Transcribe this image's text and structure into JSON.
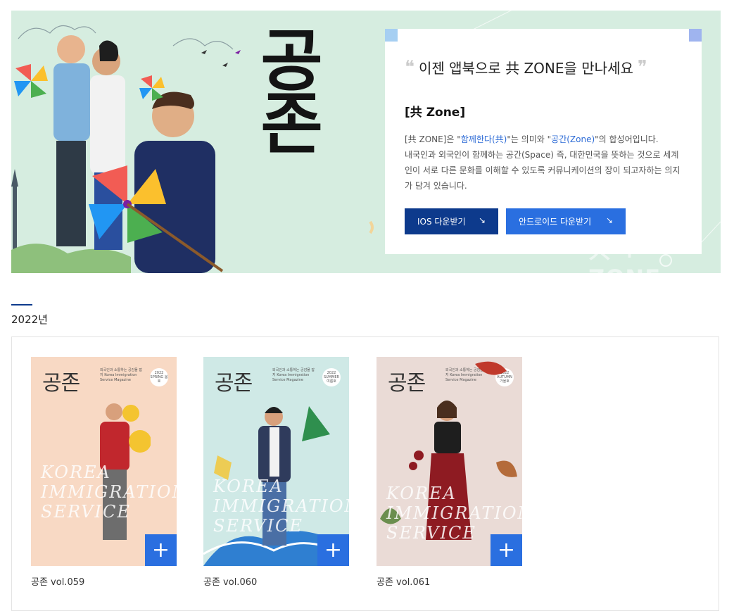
{
  "banner": {
    "logo": "공존",
    "headline": "이젠 앱북으로 共 ZONE을 만나세요",
    "zone_title": "[共 Zone]",
    "desc_prefix": "[共 ZONE]은 \"",
    "desc_hl1": "함께한다(共)",
    "desc_mid": "\"는 의미와 \"",
    "desc_hl2": "공간(Zone)",
    "desc_rest": "\"의 합성어입니다.",
    "desc_line2": "내국인과 외국인이 함께하는 공간(Space) 즉, 대한민국을 뜻하는 것으로 세계인이 서로 다른 문화를 이해할 수 있도록 커뮤니케이션의 장이 되고자하는 의지가 담겨 있습니다.",
    "ios_button": "IOS 다운받기",
    "android_button": "안드로이드 다운받기",
    "watermark": "共 + ZONE"
  },
  "section": {
    "year": "2022년"
  },
  "magazines": [
    {
      "label": "공존 vol.059",
      "cover_title": "공존",
      "cover_sub": "외국인과 소통하는 공감물 잡지 Korea Immigration Service Magazine",
      "season": "2022 SPRING 봄호",
      "script": "KOREA IMMIGRATION SERVICE",
      "bg": "#f8d9c4"
    },
    {
      "label": "공존 vol.060",
      "cover_title": "공존",
      "cover_sub": "외국인과 소통하는 공감물 잡지 Korea Immigration Service Magazine",
      "season": "2022 SUMMER 여름호",
      "script": "KOREA IMMIGRATION SERVICE",
      "bg": "#cfe9e6"
    },
    {
      "label": "공존 vol.061",
      "cover_title": "공존",
      "cover_sub": "외국인과 소통하는 공감물 잡지 Korea Immigration Service Magazine",
      "season": "2022 AUTUMN 가을호",
      "script": "KOREA IMMIGRATION SERVICE",
      "bg": "#eadbd6"
    }
  ],
  "colors": {
    "banner_bg": "#d6ede0",
    "ios_button": "#0d3a8c",
    "android_button": "#2a6fe0",
    "plus_button": "#2a6fe0",
    "highlight_text": "#2d6bd6"
  }
}
